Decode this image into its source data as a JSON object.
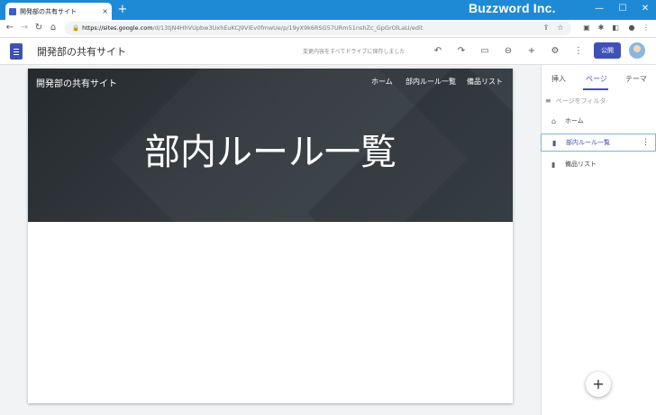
{
  "browser": {
    "tab_title": "開発部の共有サイト",
    "tab_close": "×",
    "new_tab": "+",
    "brand": "Buzzword Inc.",
    "window_controls": {
      "minimize": "—",
      "maximize": "☐",
      "close": "✕"
    },
    "url_domain": "https://sites.google.com",
    "url_path": "/d/13tjN4HhVUpbw3UxhEuKCJ9ViEv0fmwUe/p/19yX9k6RSG57URm51nshZc_GpGrOlLaLI/edit"
  },
  "sites": {
    "site_name": "開発部の共有サイト",
    "save_status": "変更内容をすべてドライブに保存しました",
    "publish_label": "公開"
  },
  "hero": {
    "site_title": "開発部の共有サイト",
    "nav": [
      "ホーム",
      "部内ルール一覧",
      "備品リスト"
    ],
    "page_title": "部内ルール一覧"
  },
  "panel": {
    "tabs": [
      "挿入",
      "ページ",
      "テーマ"
    ],
    "active_tab": "ページ",
    "filter_placeholder": "ページをフィルタ",
    "pages": [
      {
        "label": "ホーム",
        "icon": "home-icon"
      },
      {
        "label": "部内ルール一覧",
        "icon": "page-icon",
        "selected": true
      },
      {
        "label": "備品リスト",
        "icon": "page-icon"
      }
    ],
    "fab_label": "+"
  },
  "colors": {
    "accent": "#3f51b5",
    "titlebar": "#1e8ad6"
  }
}
